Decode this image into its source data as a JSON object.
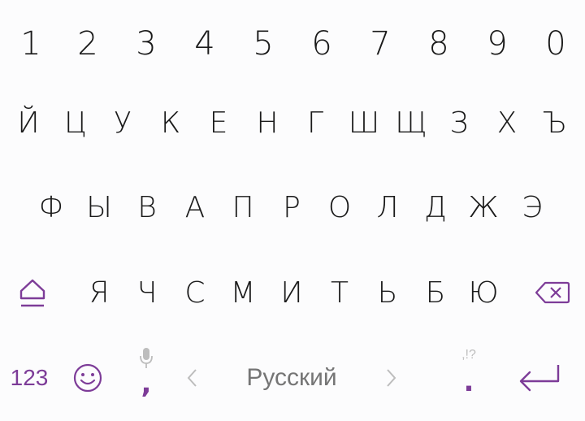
{
  "keyboard": {
    "number_row": [
      "1",
      "2",
      "3",
      "4",
      "5",
      "6",
      "7",
      "8",
      "9",
      "0"
    ],
    "row1": [
      "Й",
      "Ц",
      "У",
      "К",
      "Е",
      "Н",
      "Г",
      "Ш",
      "Щ",
      "З",
      "Х",
      "Ъ"
    ],
    "row2": [
      "Ф",
      "Ы",
      "В",
      "А",
      "П",
      "Р",
      "О",
      "Л",
      "Д",
      "Ж",
      "Э"
    ],
    "row3": [
      "Я",
      "Ч",
      "С",
      "М",
      "И",
      "Т",
      "Ь",
      "Б",
      "Ю"
    ],
    "bottom": {
      "symbols_label": "123",
      "comma": ",",
      "space_label": "Русский",
      "period": ".",
      "period_hint": ",!?"
    },
    "icons": {
      "shift": "shift-icon",
      "backspace": "backspace-icon",
      "emoji": "emoji-icon",
      "mic": "microphone-icon",
      "left": "chevron-left-icon",
      "right": "chevron-right-icon",
      "enter": "enter-icon"
    },
    "colors": {
      "accent": "#7d3c98",
      "text": "#1a1a1a",
      "muted": "#bdbdbd",
      "space_text": "#757575",
      "background": "#fcfcfd"
    }
  }
}
